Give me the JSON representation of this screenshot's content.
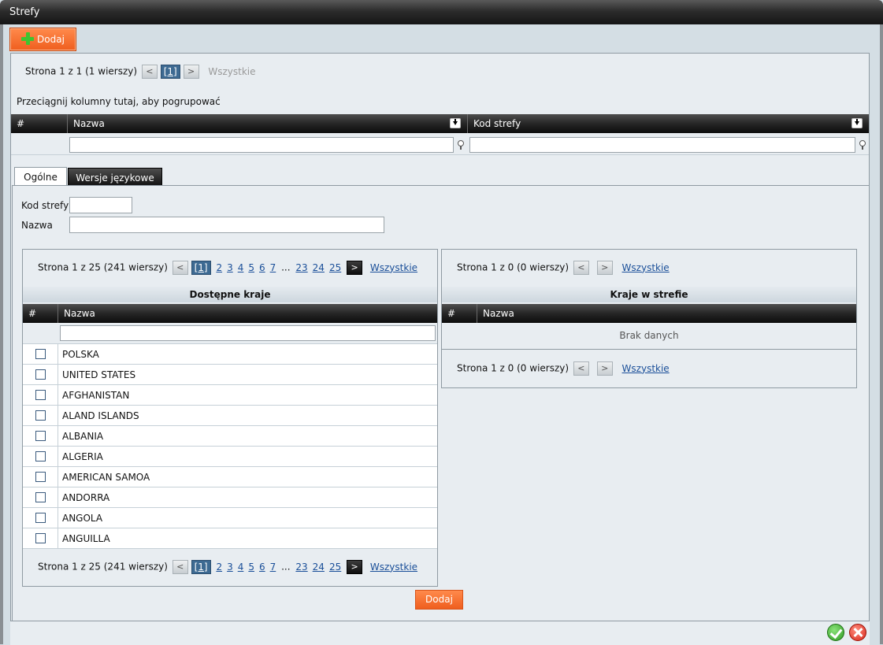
{
  "window": {
    "title": "Strefy"
  },
  "toolbar": {
    "add_label": "Dodaj"
  },
  "main_grid": {
    "pager": {
      "text": "Strona 1 z 1 (1 wierszy)",
      "current": "[1]",
      "all": "Wszystkie"
    },
    "group_hint": "Przeciągnij kolumny tutaj, aby pogrupować",
    "columns": [
      "#",
      "Nazwa",
      "Kod strefy"
    ]
  },
  "tabs": [
    {
      "label": "Ogólne",
      "active": true
    },
    {
      "label": "Wersje językowe",
      "active": false
    }
  ],
  "form": {
    "kod_strefy_label": "Kod strefy",
    "kod_strefy_value": "",
    "nazwa_label": "Nazwa",
    "nazwa_value": ""
  },
  "available": {
    "caption": "Dostępne kraje",
    "pager": {
      "text": "Strona 1 z 25 (241 wierszy)",
      "current": "[1]",
      "pages": [
        "2",
        "3",
        "4",
        "5",
        "6",
        "7"
      ],
      "ellipsis": "...",
      "tail_pages": [
        "23",
        "24",
        "25"
      ],
      "all": "Wszystkie"
    },
    "columns": [
      "#",
      "Nazwa"
    ],
    "rows": [
      "POLSKA",
      "UNITED STATES",
      "AFGHANISTAN",
      "ALAND ISLANDS",
      "ALBANIA",
      "ALGERIA",
      "AMERICAN SAMOA",
      "ANDORRA",
      "ANGOLA",
      "ANGUILLA"
    ]
  },
  "in_zone": {
    "caption": "Kraje w strefie",
    "pager": {
      "text": "Strona 1 z 0 (0 wierszy)",
      "all": "Wszystkie"
    },
    "columns": [
      "#",
      "Nazwa"
    ],
    "empty": "Brak danych"
  },
  "add_button": "Dodaj",
  "icons": {
    "add": "plus-icon",
    "sort": "sort-down-icon",
    "filter": "filter-icon",
    "prev": "chevron-left-icon",
    "next": "chevron-right-icon",
    "ok": "check-icon",
    "cancel": "close-icon"
  },
  "colors": {
    "accent": "#f26a2c",
    "plus": "#3fc430",
    "link": "#1a4f99"
  }
}
